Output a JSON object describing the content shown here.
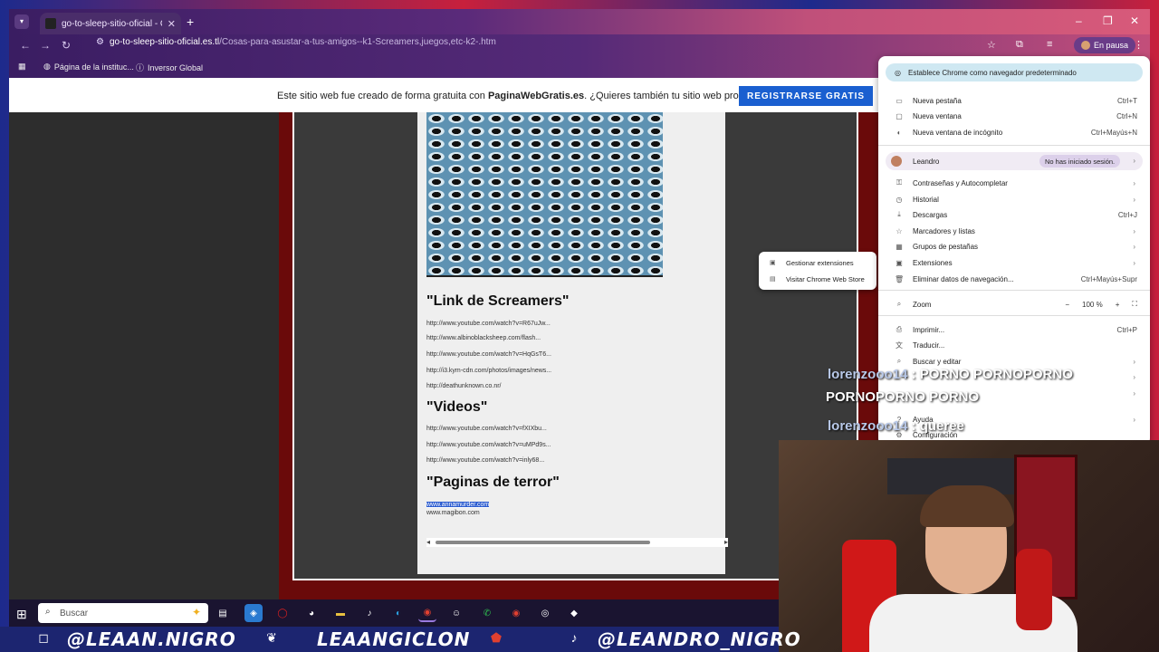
{
  "browser": {
    "tab_title": "go-to-sleep-sitio-oficial - Cosas",
    "url_host": "go-to-sleep-sitio-oficial.es.tl",
    "url_path": "/Cosas-para-asustar-a-tus-amigos--k1-Screamers,juegos,etc-k2-.htm",
    "paused_label": "En pausa",
    "bookmarks": [
      "Página de la instituc...",
      "Inversor Global"
    ]
  },
  "banner": {
    "text_pre": "Este sitio web fue creado de forma gratuita con ",
    "brand": "PaginaWebGratis.es",
    "text_post": ". ¿Quieres también tu sitio web propio?",
    "cta": "REGISTRARSE GRATIS"
  },
  "page": {
    "section1": "\"Link de Screamers\"",
    "links1": [
      "http://www.youtube.com/watch?v=R67uJw...",
      "http://www.albinoblacksheep.com/flash...",
      "http://www.youtube.com/watch?v=HqGsT6...",
      "http://i3.kym-cdn.com/photos/images/news...",
      "http://deathunknown.co.nr/"
    ],
    "section2": "\"Videos\"",
    "links2": [
      "http://www.youtube.com/watch?v=fXIXbu...",
      "http://www.youtube.com/watch?v=uMPd9s...",
      "http://www.youtube.com/watch?v=inly68..."
    ],
    "section3": "\"Paginas de terror\"",
    "links3": [
      "www.annamurder.com",
      "www.magibon.com"
    ]
  },
  "menu": {
    "default_prompt": "Establece Chrome como navegador predeterminado",
    "items": [
      {
        "label": "Nueva pestaña",
        "shortcut": "Ctrl+T",
        "icon": "new-tab-icon"
      },
      {
        "label": "Nueva ventana",
        "shortcut": "Ctrl+N",
        "icon": "new-window-icon"
      },
      {
        "label": "Nueva ventana de incógnito",
        "shortcut": "Ctrl+Mayús+N",
        "icon": "incognito-icon"
      }
    ],
    "profile": {
      "name": "Leandro",
      "status": "No has iniciado sesión."
    },
    "items2": [
      {
        "label": "Contraseñas y Autocompletar",
        "shortcut": "",
        "icon": "key-icon"
      },
      {
        "label": "Historial",
        "shortcut": "",
        "icon": "history-icon"
      },
      {
        "label": "Descargas",
        "shortcut": "Ctrl+J",
        "icon": "download-icon"
      },
      {
        "label": "Marcadores y listas",
        "shortcut": "",
        "icon": "star-icon"
      },
      {
        "label": "Grupos de pestañas",
        "shortcut": "",
        "icon": "tab-groups-icon"
      },
      {
        "label": "Extensiones",
        "shortcut": "",
        "icon": "puzzle-icon"
      },
      {
        "label": "Eliminar datos de navegación...",
        "shortcut": "Ctrl+Mayús+Supr",
        "icon": "trash-icon"
      }
    ],
    "zoom_label": "Zoom",
    "zoom_value": "100 %",
    "items3": [
      {
        "label": "Imprimir...",
        "shortcut": "Ctrl+P",
        "icon": "print-icon"
      },
      {
        "label": "Traducir...",
        "shortcut": "",
        "icon": "translate-icon"
      },
      {
        "label": "Buscar y editar",
        "shortcut": "",
        "icon": "search-icon"
      }
    ],
    "items4": [
      {
        "label": "Ayuda",
        "icon": "help-icon"
      },
      {
        "label": "Configuración",
        "icon": "settings-icon"
      }
    ]
  },
  "submenu": {
    "items": [
      "Gestionar extensiones",
      "Visitar Chrome Web Store"
    ]
  },
  "chat": [
    {
      "user": "lorenzooo14",
      "msg": ": PORNO PORNOPORNO"
    },
    {
      "user": "",
      "msg": "PORNOPORNO PORNO"
    },
    {
      "user": "lorenzooo14",
      "msg": ": queree"
    }
  ],
  "taskbar": {
    "search_placeholder": "Buscar"
  },
  "social": {
    "instagram": "@LEAAN.NIGRO",
    "kick": "LEAANGICLON",
    "tiktok": "@LEANDRO_NIGRO"
  }
}
